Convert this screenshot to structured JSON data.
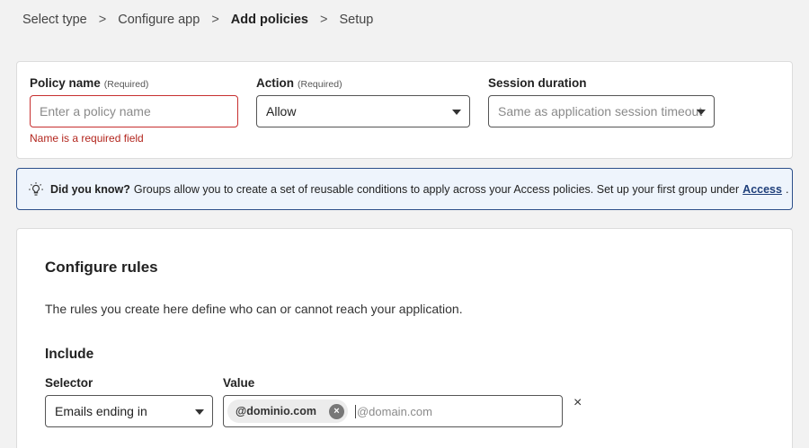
{
  "breadcrumb": {
    "items": [
      "Select type",
      "Configure app",
      "Add policies",
      "Setup"
    ],
    "separator": ">"
  },
  "policy": {
    "name_label": "Policy name",
    "name_required": "(Required)",
    "name_placeholder": "Enter a policy name",
    "name_error": "Name is a required field",
    "action_label": "Action",
    "action_required": "(Required)",
    "action_value": "Allow",
    "session_label": "Session duration",
    "session_placeholder": "Same as application session timeout"
  },
  "tip": {
    "icon": "lightbulb-icon",
    "heading": "Did you know?",
    "text": "Groups allow you to create a set of reusable conditions to apply across your Access policies. Set up your first group under",
    "link": "Access",
    "trailing": "."
  },
  "rules": {
    "title": "Configure rules",
    "description": "The rules you create here define who can or cannot reach your application.",
    "include_title": "Include",
    "selector_label": "Selector",
    "selector_value": "Emails ending in",
    "value_label": "Value",
    "chip": "@dominio.com",
    "chip_remove": "×",
    "value_placeholder": "@domain.com",
    "row_remove": "×"
  },
  "colors": {
    "error": "#c72f2f",
    "tip_background": "#eef4fc",
    "tip_border": "#2c4f8a",
    "link": "#1f3f7a"
  }
}
